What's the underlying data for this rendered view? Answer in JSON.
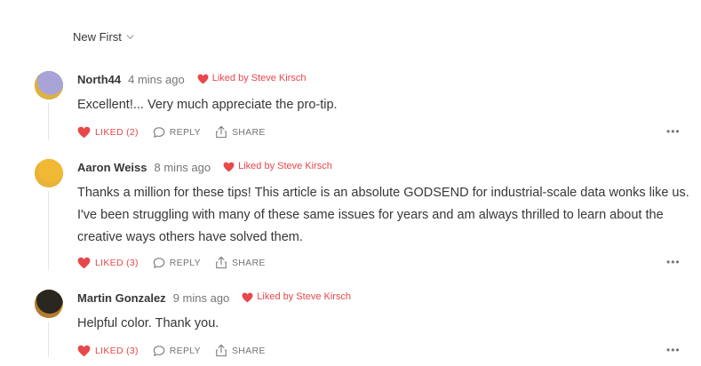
{
  "sort": {
    "label": "New First",
    "icon": "chevron-down-icon"
  },
  "colors": {
    "accent": "#e8474b",
    "text": "#363737",
    "muted": "#757575"
  },
  "comments": [
    {
      "author": "North44",
      "time": "4 mins ago",
      "liked_by": "Liked by Steve Kirsch",
      "body": "Excellent!... Very much appreciate the pro-tip.",
      "like_label": "LIKED (2)",
      "reply_label": "REPLY",
      "share_label": "SHARE",
      "more_label": "•••"
    },
    {
      "author": "Aaron Weiss",
      "time": "8 mins ago",
      "liked_by": "Liked by Steve Kirsch",
      "body": "Thanks a million for these tips! This article is an absolute GODSEND for industrial-scale data wonks like us. I've been struggling with many of these same issues for years and am always thrilled to learn about the creative ways others have solved them.",
      "like_label": "LIKED (3)",
      "reply_label": "REPLY",
      "share_label": "SHARE",
      "more_label": "•••"
    },
    {
      "author": "Martin Gonzalez",
      "time": "9 mins ago",
      "liked_by": "Liked by Steve Kirsch",
      "body": "Helpful color. Thank you.",
      "like_label": "LIKED (3)",
      "reply_label": "REPLY",
      "share_label": "SHARE",
      "more_label": "•••"
    }
  ]
}
